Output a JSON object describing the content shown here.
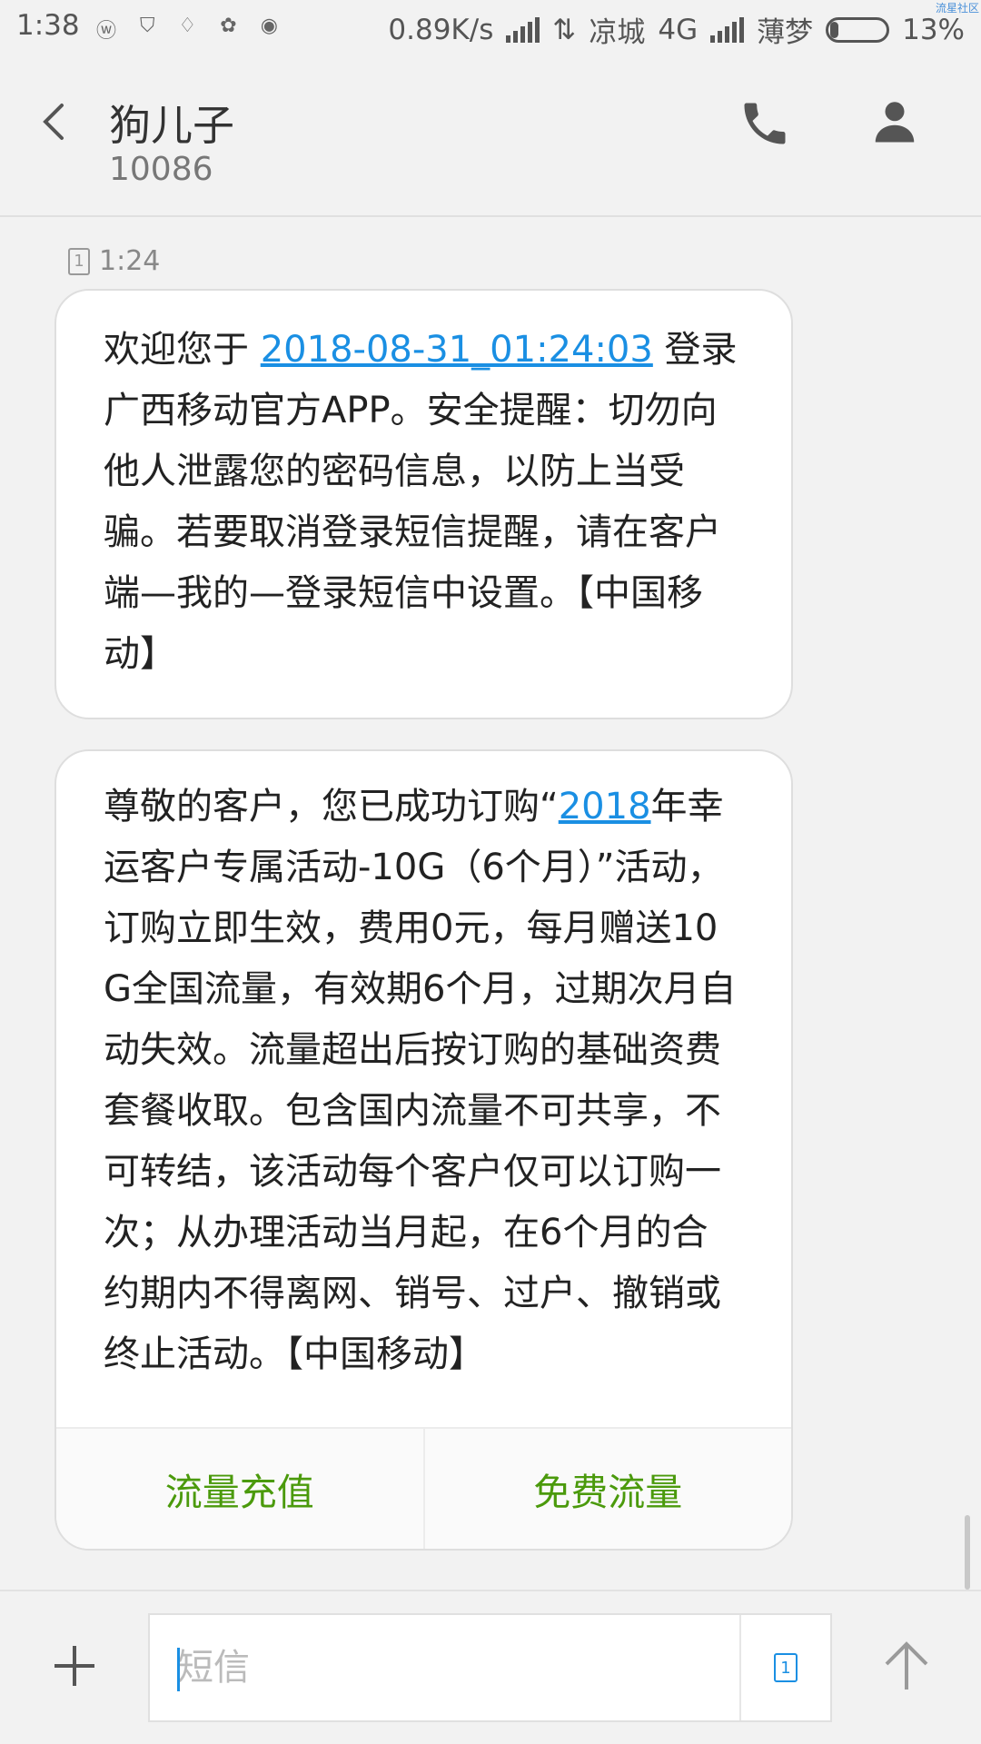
{
  "status_bar": {
    "time": "1:38",
    "speed": "0.89K/s",
    "carrier1": "凉城",
    "network": "4G",
    "carrier2": "薄梦",
    "battery": "13%",
    "battery_level": 0.13,
    "watermark": "流星社区",
    "notification_icons": [
      "weibo-icon",
      "shield-icon",
      "bell-icon",
      "flower-icon",
      "qq-icon"
    ]
  },
  "header": {
    "contact_name": "狗儿子",
    "number": "10086"
  },
  "messages": {
    "sim_label": "1",
    "time": "1:24",
    "msg1": {
      "before": "欢迎您于 ",
      "link": "2018-08-31_01:24:03",
      "after": " 登录广西移动官方APP。安全提醒：切勿向他人泄露您的密码信息，以防上当受骗。若要取消登录短信提醒，请在客户端—我的—登录短信中设置。【中国移动】"
    },
    "msg2": {
      "before": "尊敬的客户，您已成功订购“",
      "link": "2018",
      "after": "年幸运客户专属活动-10G（6个月）”活动，订购立即生效，费用0元，每月赠送10G全国流量，有效期6个月，过期次月自动失效。流量超出后按订购的基础资费套餐收取。包含国内流量不可共享，不可转结，该活动每个客户仅可以订购一次；从办理活动当月起，在6个月的合约期内不得离网、销号、过户、撤销或终止活动。【中国移动】",
      "action_left": "流量充值",
      "action_right": "免费流量"
    }
  },
  "composer": {
    "placeholder": "短信",
    "sim_label": "1"
  },
  "colors": {
    "link": "#1a8fe3",
    "action": "#4b9a0c",
    "background": "#f2f2f2"
  }
}
